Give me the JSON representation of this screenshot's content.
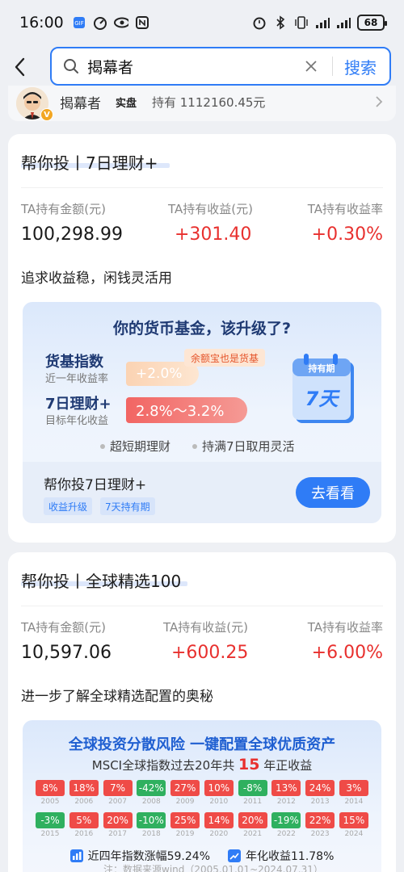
{
  "status_bar": {
    "time": "16:00",
    "battery": "68"
  },
  "search": {
    "query": "揭幕者",
    "button": "搜索"
  },
  "user": {
    "name": "揭幕者",
    "tag": "实盘",
    "holding": "持有 1112160.45元",
    "badge": "V"
  },
  "cards": [
    {
      "title": "帮你投丨7日理财+",
      "cols": [
        {
          "label": "TA持有金额(元)",
          "value": "100,298.99"
        },
        {
          "label": "TA持有收益(元)",
          "value": "+301.40"
        },
        {
          "label": "TA持有收益率",
          "value": "+0.30%"
        }
      ],
      "desc": "追求收益稳，闲钱灵活用",
      "promo": {
        "headline": "你的货币基金，该升级了?",
        "row1_title": "货基指数",
        "row1_sub": "近一年收益率",
        "row1_value": "+2.0%",
        "row1_note": "余额宝也是货基",
        "row2_title": "7日理财+",
        "row2_sub": "目标年化收益",
        "row2_value": "2.8%～3.2%",
        "calendar_top": "持有期",
        "calendar_main": "7天",
        "bullet1": "超短期理财",
        "bullet2": "持满7日取用灵活",
        "footer_title": "帮你投7日理财+",
        "tag1": "收益升级",
        "tag2": "7天持有期",
        "cta": "去看看"
      }
    },
    {
      "title": "帮你投丨全球精选100",
      "cols": [
        {
          "label": "TA持有金额(元)",
          "value": "10,597.06"
        },
        {
          "label": "TA持有收益(元)",
          "value": "+600.25"
        },
        {
          "label": "TA持有收益率",
          "value": "+6.00%"
        }
      ],
      "desc": "进一步了解全球精选配置的奥秘",
      "promo": {
        "headline": "全球投资分散风险 一键配置全球优质资产",
        "sub_before": "MSCI全球指数过去20年共",
        "sub_number": "15",
        "sub_after": "年正收益",
        "row1": [
          {
            "value": "8%",
            "year": "2005",
            "positive": true
          },
          {
            "value": "18%",
            "year": "2006",
            "positive": true
          },
          {
            "value": "7%",
            "year": "2007",
            "positive": true
          },
          {
            "value": "-42%",
            "year": "2008",
            "positive": false
          },
          {
            "value": "27%",
            "year": "2009",
            "positive": true
          },
          {
            "value": "10%",
            "year": "2010",
            "positive": true
          },
          {
            "value": "-8%",
            "year": "2011",
            "positive": false
          },
          {
            "value": "13%",
            "year": "2012",
            "positive": true
          },
          {
            "value": "24%",
            "year": "2013",
            "positive": true
          },
          {
            "value": "3%",
            "year": "2014",
            "positive": true
          }
        ],
        "row2": [
          {
            "value": "-3%",
            "year": "2015",
            "positive": false
          },
          {
            "value": "5%",
            "year": "2016",
            "positive": true
          },
          {
            "value": "20%",
            "year": "2017",
            "positive": true
          },
          {
            "value": "-10%",
            "year": "2018",
            "positive": false
          },
          {
            "value": "25%",
            "year": "2019",
            "positive": true
          },
          {
            "value": "14%",
            "year": "2020",
            "positive": true
          },
          {
            "value": "20%",
            "year": "2021",
            "positive": true
          },
          {
            "value": "-19%",
            "year": "2022",
            "positive": false
          },
          {
            "value": "22%",
            "year": "2023",
            "positive": true
          },
          {
            "value": "15%",
            "year": "2024",
            "positive": true
          }
        ],
        "stat1": "近四年指数涨幅59.24%",
        "stat2": "年化收益11.78%",
        "source": "注：数据来源wind（2005.01.01~2024.07.31）"
      }
    }
  ],
  "colors": {
    "accent": "#2f7cf6",
    "red": "#e8302e",
    "green": "#2fb05f"
  }
}
